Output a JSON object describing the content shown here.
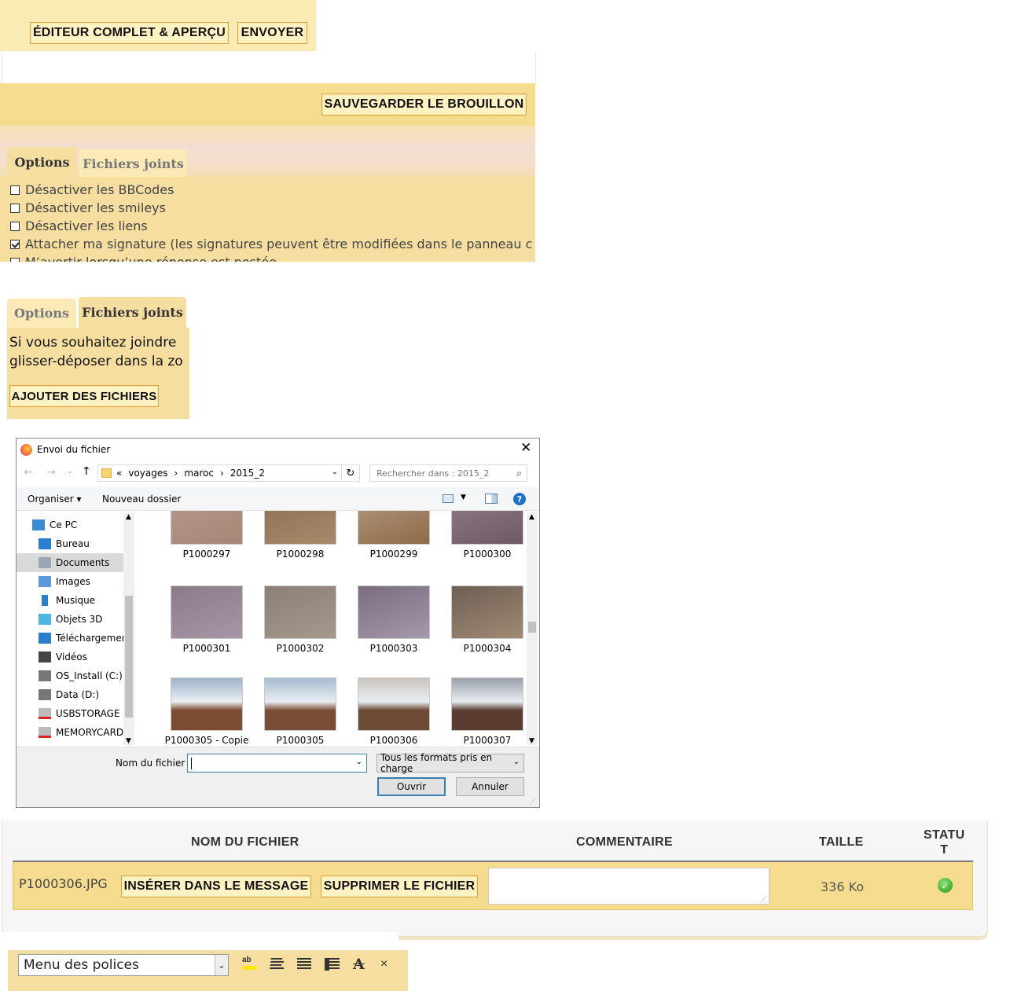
{
  "top_buttons": {
    "full_editor": "ÉDITEUR COMPLET & APERÇU",
    "send": "ENVOYER"
  },
  "draft": {
    "save_draft": "SAUVEGARDER LE BROUILLON"
  },
  "options_panel": {
    "tabs": [
      "Options",
      "Fichiers joints"
    ],
    "options": [
      {
        "label": "Désactiver les BBCodes",
        "checked": false
      },
      {
        "label": "Désactiver les smileys",
        "checked": false
      },
      {
        "label": "Désactiver les liens",
        "checked": false
      },
      {
        "label": "Attacher ma signature (les signatures peuvent être modifiées dans le panneau c",
        "checked": true
      },
      {
        "label": "M’avertir lorsqu’une réponse est postée",
        "checked": false
      }
    ]
  },
  "attachments_panel": {
    "tabs": [
      "Options",
      "Fichiers joints"
    ],
    "text_line1": "Si vous souhaitez joindre",
    "text_line2": "glisser-déposer dans la zo",
    "add_files": "AJOUTER DES FICHIERS"
  },
  "file_dialog": {
    "title": "Envoi du fichier",
    "breadcrumb": [
      "«",
      "voyages",
      "›",
      "maroc",
      "›",
      "2015_2"
    ],
    "search_placeholder": "Rechercher dans : 2015_2",
    "organize": "Organiser ▾",
    "new_folder": "Nouveau dossier",
    "tree": [
      {
        "label": "Ce PC",
        "icon": "computer-icon"
      },
      {
        "label": "Bureau",
        "icon": "desktop-icon"
      },
      {
        "label": "Documents",
        "icon": "documents-icon"
      },
      {
        "label": "Images",
        "icon": "images-icon"
      },
      {
        "label": "Musique",
        "icon": "music-icon"
      },
      {
        "label": "Objets 3D",
        "icon": "objects-3d-icon"
      },
      {
        "label": "Téléchargements",
        "icon": "download-icon"
      },
      {
        "label": "Vidéos",
        "icon": "video-icon"
      },
      {
        "label": "OS_Install (C:)",
        "icon": "drive-icon"
      },
      {
        "label": "Data (D:)",
        "icon": "drive-icon"
      },
      {
        "label": "USBSTORAGE (\\\\",
        "icon": "network-drive-icon"
      },
      {
        "label": "MEMORYCARD",
        "icon": "network-drive-icon"
      }
    ],
    "files": [
      "P1000297",
      "P1000298",
      "P1000299",
      "P1000300",
      "P1000301",
      "P1000302",
      "P1000303",
      "P1000304",
      "P1000305 - Copie",
      "P1000305",
      "P1000306",
      "P1000307"
    ],
    "filename_label": "Nom du fichier :",
    "filename_value": "",
    "filetype": "Tous les formats pris en charge",
    "open": "Ouvrir",
    "cancel": "Annuler"
  },
  "attachment_table": {
    "headers": {
      "name": "NOM DU FICHIER",
      "comment": "COMMENTAIRE",
      "size": "TAILLE",
      "status_line1": "STATU",
      "status_line2": "T"
    },
    "row": {
      "filename": "P1000306.JPG",
      "insert": "INSÉRER DANS LE MESSAGE",
      "delete": "SUPPRIMER LE FICHIER",
      "comment": "",
      "size": "336 Ko"
    }
  },
  "bottom_toolbar": {
    "font_menu": "Menu des polices",
    "extra": "×"
  },
  "colors": {
    "panel_yellow": "#f5dea0",
    "button_border": "#d8a246",
    "tab_inactive": "#fbeab5"
  }
}
